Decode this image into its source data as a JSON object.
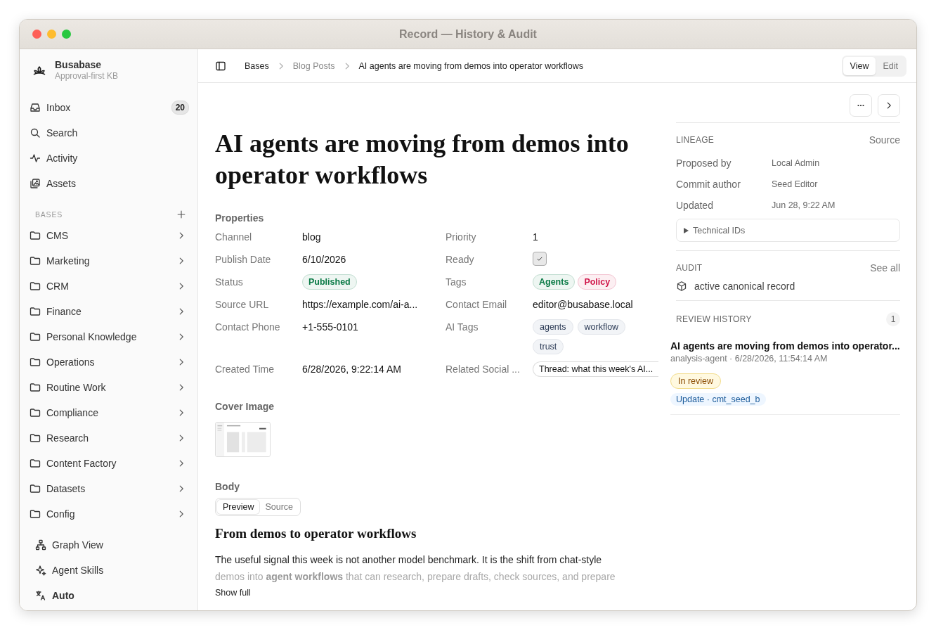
{
  "window": {
    "title": "Record — History & Audit"
  },
  "sidebar": {
    "brand": {
      "name": "Busabase",
      "subtitle": "Approval-first KB"
    },
    "nav": [
      {
        "label": "Inbox",
        "kind": "inbox",
        "badge": "20"
      },
      {
        "label": "Search",
        "kind": "search"
      },
      {
        "label": "Activity",
        "kind": "activity"
      },
      {
        "label": "Assets",
        "kind": "assets"
      }
    ],
    "bases_heading": "BASES",
    "bases": [
      "CMS",
      "Marketing",
      "CRM",
      "Finance",
      "Personal Knowledge",
      "Operations",
      "Routine Work",
      "Compliance",
      "Research",
      "Content Factory",
      "Datasets",
      "Config"
    ],
    "footer": [
      {
        "label": "Graph View",
        "kind": "graph"
      },
      {
        "label": "Agent Skills",
        "kind": "skills"
      },
      {
        "label": "Auto",
        "kind": "language"
      }
    ]
  },
  "breadcrumb": [
    {
      "label": "Bases",
      "kind": "link"
    },
    {
      "label": "Blog Posts",
      "kind": "muted"
    },
    {
      "label": "AI agents are moving from demos into operator workflows",
      "kind": "current"
    }
  ],
  "mode_toggle": [
    {
      "label": "View",
      "selected": true
    },
    {
      "label": "Edit",
      "selected": false
    }
  ],
  "record": {
    "title": "AI agents are moving from demos into operator workflows",
    "properties_heading": "Properties",
    "properties": [
      {
        "label": "Channel",
        "kind": "text",
        "value": "blog"
      },
      {
        "label": "Priority",
        "kind": "text",
        "value": "1"
      },
      {
        "label": "Publish Date",
        "kind": "text",
        "value": "6/10/2026"
      },
      {
        "label": "Ready",
        "kind": "checkbox",
        "checked": true
      },
      {
        "label": "Status",
        "kind": "tags",
        "tags": [
          {
            "label": "Published",
            "color": "#0a7a46"
          }
        ]
      },
      {
        "label": "Tags",
        "kind": "tags",
        "tags": [
          {
            "label": "Agents",
            "color": "#0a7a46"
          },
          {
            "label": "Policy",
            "color": "#d0164a"
          }
        ]
      },
      {
        "label": "Source URL",
        "kind": "text",
        "value": "https://example.com/ai-a..."
      },
      {
        "label": "Contact Email",
        "kind": "text",
        "value": "editor@busabase.local"
      },
      {
        "label": "Contact Phone",
        "kind": "text",
        "value": "+1-555-0101"
      },
      {
        "label": "AI Tags",
        "kind": "chips",
        "chips": [
          "agents",
          "workflow",
          "trust"
        ]
      },
      {
        "label": "Created Time",
        "kind": "text",
        "value": "6/28/2026, 9:22:14 AM"
      },
      {
        "label": "Related Social ...",
        "kind": "link",
        "value": "Thread: what this week's AI..."
      }
    ],
    "cover_heading": "Cover Image",
    "body_heading": "Body",
    "body_tabs": [
      {
        "label": "Preview",
        "selected": true
      },
      {
        "label": "Source",
        "selected": false
      }
    ],
    "body": {
      "heading": "From demos to operator workflows",
      "lines": [
        "The useful signal this week is not another model benchmark. It is the shift from chat-style",
        "demos into **agent workflows** that can research, prepare drafts, check sources, and prepare"
      ],
      "show_full": "Show full"
    }
  },
  "panel": {
    "lineage": {
      "heading": "LINEAGE",
      "action": "Source",
      "rows": [
        {
          "label": "Proposed by",
          "value": "Local Admin"
        },
        {
          "label": "Commit author",
          "value": "Seed Editor"
        },
        {
          "label": "Updated",
          "value": "Jun 28, 9:22 AM"
        }
      ],
      "technical_ids": "Technical IDs"
    },
    "audit": {
      "heading": "AUDIT",
      "action": "See all",
      "entry": "active canonical record"
    },
    "review_history": {
      "heading": "REVIEW HISTORY",
      "count": "1",
      "item": {
        "title": "AI agents are moving from demos into operator...",
        "meta": "analysis-agent · 6/28/2026, 11:54:14 AM",
        "status": "In review",
        "commit": "Update · cmt_seed_b"
      }
    }
  }
}
